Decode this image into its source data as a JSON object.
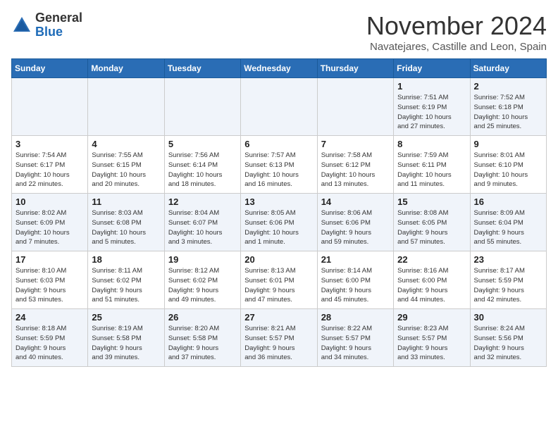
{
  "header": {
    "logo_line1": "General",
    "logo_line2": "Blue",
    "month": "November 2024",
    "location": "Navatejares, Castille and Leon, Spain"
  },
  "weekdays": [
    "Sunday",
    "Monday",
    "Tuesday",
    "Wednesday",
    "Thursday",
    "Friday",
    "Saturday"
  ],
  "weeks": [
    [
      {
        "day": "",
        "info": ""
      },
      {
        "day": "",
        "info": ""
      },
      {
        "day": "",
        "info": ""
      },
      {
        "day": "",
        "info": ""
      },
      {
        "day": "",
        "info": ""
      },
      {
        "day": "1",
        "info": "Sunrise: 7:51 AM\nSunset: 6:19 PM\nDaylight: 10 hours\nand 27 minutes."
      },
      {
        "day": "2",
        "info": "Sunrise: 7:52 AM\nSunset: 6:18 PM\nDaylight: 10 hours\nand 25 minutes."
      }
    ],
    [
      {
        "day": "3",
        "info": "Sunrise: 7:54 AM\nSunset: 6:17 PM\nDaylight: 10 hours\nand 22 minutes."
      },
      {
        "day": "4",
        "info": "Sunrise: 7:55 AM\nSunset: 6:15 PM\nDaylight: 10 hours\nand 20 minutes."
      },
      {
        "day": "5",
        "info": "Sunrise: 7:56 AM\nSunset: 6:14 PM\nDaylight: 10 hours\nand 18 minutes."
      },
      {
        "day": "6",
        "info": "Sunrise: 7:57 AM\nSunset: 6:13 PM\nDaylight: 10 hours\nand 16 minutes."
      },
      {
        "day": "7",
        "info": "Sunrise: 7:58 AM\nSunset: 6:12 PM\nDaylight: 10 hours\nand 13 minutes."
      },
      {
        "day": "8",
        "info": "Sunrise: 7:59 AM\nSunset: 6:11 PM\nDaylight: 10 hours\nand 11 minutes."
      },
      {
        "day": "9",
        "info": "Sunrise: 8:01 AM\nSunset: 6:10 PM\nDaylight: 10 hours\nand 9 minutes."
      }
    ],
    [
      {
        "day": "10",
        "info": "Sunrise: 8:02 AM\nSunset: 6:09 PM\nDaylight: 10 hours\nand 7 minutes."
      },
      {
        "day": "11",
        "info": "Sunrise: 8:03 AM\nSunset: 6:08 PM\nDaylight: 10 hours\nand 5 minutes."
      },
      {
        "day": "12",
        "info": "Sunrise: 8:04 AM\nSunset: 6:07 PM\nDaylight: 10 hours\nand 3 minutes."
      },
      {
        "day": "13",
        "info": "Sunrise: 8:05 AM\nSunset: 6:06 PM\nDaylight: 10 hours\nand 1 minute."
      },
      {
        "day": "14",
        "info": "Sunrise: 8:06 AM\nSunset: 6:06 PM\nDaylight: 9 hours\nand 59 minutes."
      },
      {
        "day": "15",
        "info": "Sunrise: 8:08 AM\nSunset: 6:05 PM\nDaylight: 9 hours\nand 57 minutes."
      },
      {
        "day": "16",
        "info": "Sunrise: 8:09 AM\nSunset: 6:04 PM\nDaylight: 9 hours\nand 55 minutes."
      }
    ],
    [
      {
        "day": "17",
        "info": "Sunrise: 8:10 AM\nSunset: 6:03 PM\nDaylight: 9 hours\nand 53 minutes."
      },
      {
        "day": "18",
        "info": "Sunrise: 8:11 AM\nSunset: 6:02 PM\nDaylight: 9 hours\nand 51 minutes."
      },
      {
        "day": "19",
        "info": "Sunrise: 8:12 AM\nSunset: 6:02 PM\nDaylight: 9 hours\nand 49 minutes."
      },
      {
        "day": "20",
        "info": "Sunrise: 8:13 AM\nSunset: 6:01 PM\nDaylight: 9 hours\nand 47 minutes."
      },
      {
        "day": "21",
        "info": "Sunrise: 8:14 AM\nSunset: 6:00 PM\nDaylight: 9 hours\nand 45 minutes."
      },
      {
        "day": "22",
        "info": "Sunrise: 8:16 AM\nSunset: 6:00 PM\nDaylight: 9 hours\nand 44 minutes."
      },
      {
        "day": "23",
        "info": "Sunrise: 8:17 AM\nSunset: 5:59 PM\nDaylight: 9 hours\nand 42 minutes."
      }
    ],
    [
      {
        "day": "24",
        "info": "Sunrise: 8:18 AM\nSunset: 5:59 PM\nDaylight: 9 hours\nand 40 minutes."
      },
      {
        "day": "25",
        "info": "Sunrise: 8:19 AM\nSunset: 5:58 PM\nDaylight: 9 hours\nand 39 minutes."
      },
      {
        "day": "26",
        "info": "Sunrise: 8:20 AM\nSunset: 5:58 PM\nDaylight: 9 hours\nand 37 minutes."
      },
      {
        "day": "27",
        "info": "Sunrise: 8:21 AM\nSunset: 5:57 PM\nDaylight: 9 hours\nand 36 minutes."
      },
      {
        "day": "28",
        "info": "Sunrise: 8:22 AM\nSunset: 5:57 PM\nDaylight: 9 hours\nand 34 minutes."
      },
      {
        "day": "29",
        "info": "Sunrise: 8:23 AM\nSunset: 5:57 PM\nDaylight: 9 hours\nand 33 minutes."
      },
      {
        "day": "30",
        "info": "Sunrise: 8:24 AM\nSunset: 5:56 PM\nDaylight: 9 hours\nand 32 minutes."
      }
    ]
  ]
}
